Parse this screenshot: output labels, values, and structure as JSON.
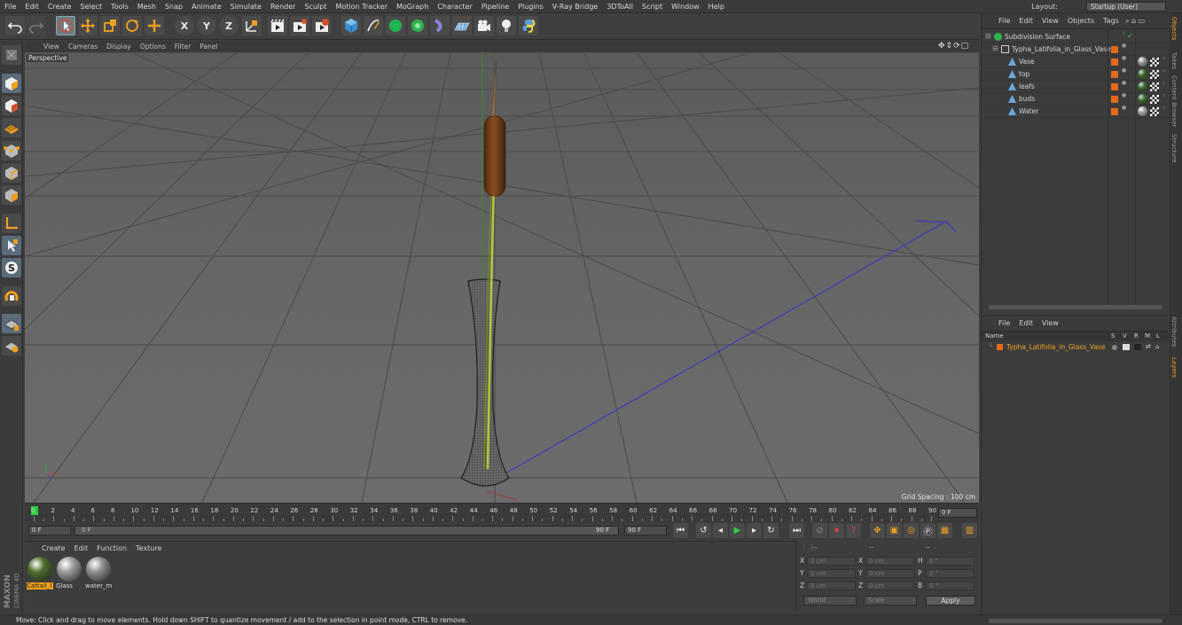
{
  "menubar": {
    "items": [
      "File",
      "Edit",
      "Create",
      "Select",
      "Tools",
      "Mesh",
      "Snap",
      "Animate",
      "Simulate",
      "Render",
      "Sculpt",
      "Motion Tracker",
      "MoGraph",
      "Character",
      "Pipeline",
      "Plugins",
      "V-Ray Bridge",
      "3DToAll",
      "Script",
      "Window",
      "Help"
    ],
    "layout_label": "Layout:",
    "layout_value": "Startup (User)"
  },
  "toolbar": {
    "axis_x": "X",
    "axis_y": "Y",
    "axis_z": "Z"
  },
  "viewport": {
    "menu": [
      "View",
      "Cameras",
      "Display",
      "Options",
      "Filter",
      "Panel"
    ],
    "label": "Perspective",
    "grid_spacing": "Grid Spacing : 100 cm"
  },
  "timeline": {
    "ticks": [
      "0",
      "2",
      "4",
      "6",
      "8",
      "10",
      "12",
      "14",
      "16",
      "18",
      "20",
      "22",
      "24",
      "26",
      "28",
      "30",
      "32",
      "34",
      "36",
      "38",
      "40",
      "42",
      "44",
      "46",
      "48",
      "50",
      "52",
      "54",
      "56",
      "58",
      "60",
      "62",
      "64",
      "66",
      "68",
      "70",
      "72",
      "74",
      "76",
      "78",
      "80",
      "82",
      "84",
      "86",
      "88",
      "90"
    ],
    "current_frame": "0 F"
  },
  "transport": {
    "start": "0 F",
    "range_start": "0 F",
    "range_end": "90 F",
    "end": "90 F"
  },
  "materials": {
    "menu": [
      "Create",
      "Edit",
      "Function",
      "Texture"
    ],
    "items": [
      {
        "name": "Cattail_l",
        "color": "#4a6a2a",
        "selected": true
      },
      {
        "name": "Glass",
        "color": "#9a9a9a",
        "selected": false
      },
      {
        "name": "water_m",
        "color": "#8c8c8c",
        "selected": false
      }
    ]
  },
  "coordinates": {
    "header": [
      "--",
      "--",
      "--"
    ],
    "rows": [
      {
        "a": "X",
        "av": "0 cm",
        "b": "X",
        "bv": "0 cm",
        "c": "H",
        "cv": "0 °"
      },
      {
        "a": "Y",
        "av": "0 cm",
        "b": "Y",
        "bv": "0 cm",
        "c": "P",
        "cv": "0 °"
      },
      {
        "a": "Z",
        "av": "0 cm",
        "b": "Z",
        "bv": "0 cm",
        "c": "B",
        "cv": "0 °"
      }
    ],
    "world": "World",
    "scale": "Scale",
    "apply": "Apply"
  },
  "status": "Move: Click and drag to move elements. Hold down SHIFT to quantize movement / add to the selection in point mode, CTRL to remove.",
  "objects": {
    "menu": [
      "File",
      "Edit",
      "View",
      "Objects",
      "Tags"
    ],
    "items": [
      {
        "name": "Subdivision Surface",
        "indent": 0
      },
      {
        "name": "Typha_Latifolia_in_Glass_Vase",
        "indent": 1
      },
      {
        "name": "Vase",
        "indent": 2
      },
      {
        "name": "top",
        "indent": 2
      },
      {
        "name": "leafs",
        "indent": 2
      },
      {
        "name": "buds",
        "indent": 2
      },
      {
        "name": "Water",
        "indent": 2
      }
    ]
  },
  "layers": {
    "menu": [
      "File",
      "Edit",
      "View"
    ],
    "columns": [
      "Name",
      "S",
      "V",
      "R",
      "M",
      "L"
    ],
    "item": "Typha_Latifolia_in_Glass_Vase"
  },
  "side_tabs": [
    "Objects",
    "Takes",
    "Content Browser",
    "Structure",
    "Attributes",
    "Layers"
  ],
  "brand": {
    "line1": "MAXON",
    "line2": "CINEMA 4D"
  }
}
